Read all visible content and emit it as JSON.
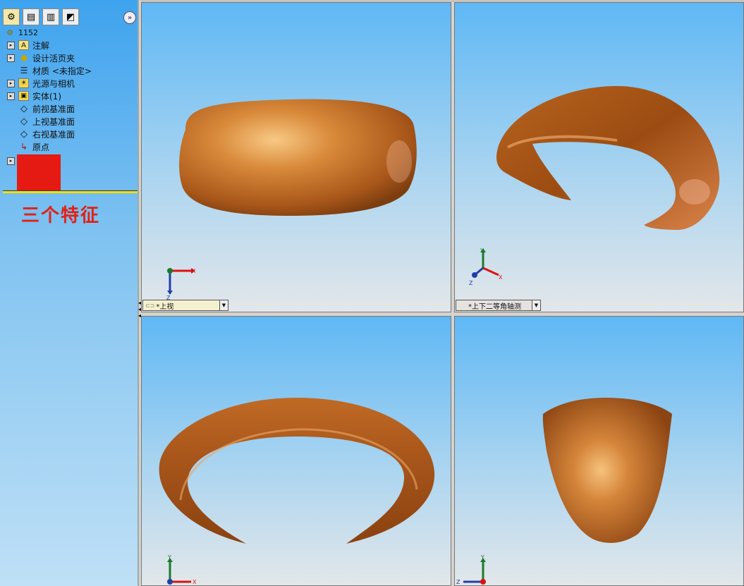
{
  "tree": {
    "root_label": "1152",
    "items": [
      {
        "label": "注解",
        "expandable": true
      },
      {
        "label": "设计活页夹",
        "expandable": true
      },
      {
        "label": "材质 <未指定>",
        "expandable": false
      },
      {
        "label": "光源与相机",
        "expandable": true
      },
      {
        "label": "实体(1)",
        "expandable": true
      },
      {
        "label": "前视基准面",
        "expandable": false
      },
      {
        "label": "上视基准面",
        "expandable": false
      },
      {
        "label": "右视基准面",
        "expandable": false
      },
      {
        "label": "原点",
        "expandable": false
      }
    ],
    "annotation": "三个特征"
  },
  "viewports": {
    "top_left": {
      "label": "*上视"
    },
    "top_right": {
      "label": "*上下二等角轴测"
    }
  },
  "triad": {
    "x": "X",
    "y": "Y",
    "z": "Z"
  },
  "colors": {
    "model": "#b9661e",
    "highlight": "#f7c07a",
    "red_block": "#e51a12",
    "annotation": "#e31f14"
  }
}
